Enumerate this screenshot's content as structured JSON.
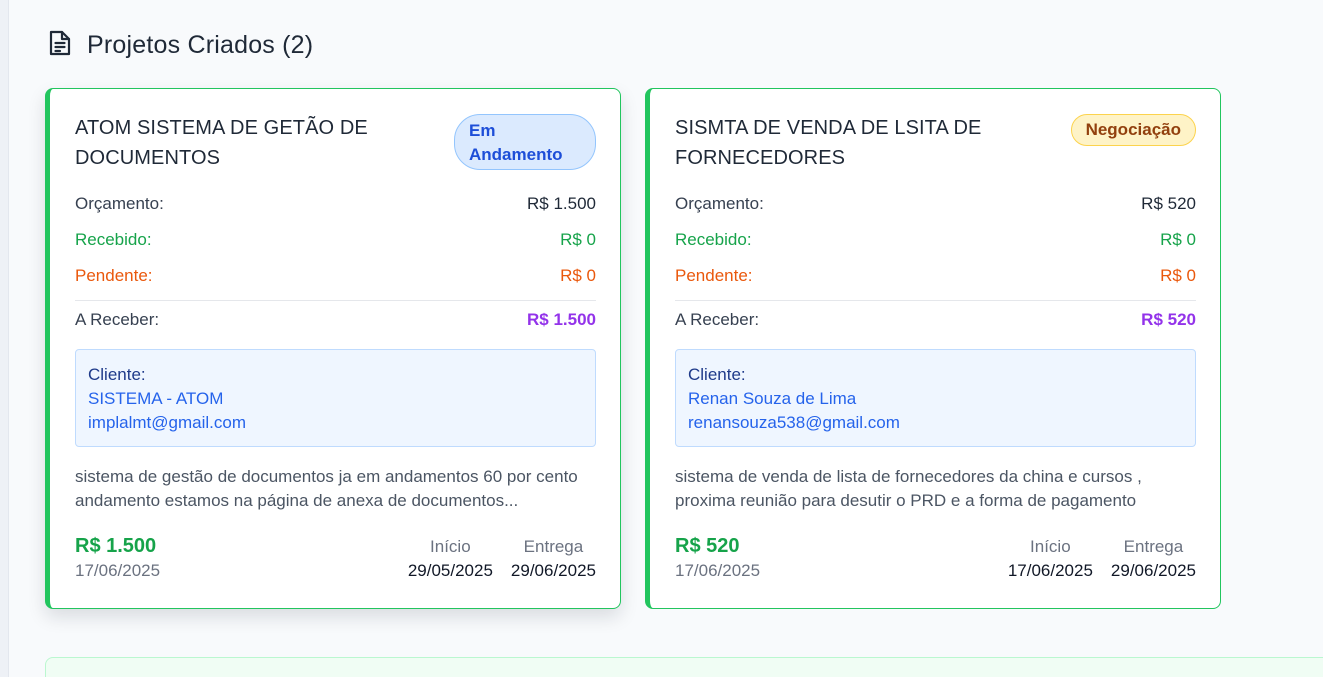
{
  "section": {
    "title": "Projetos Criados (2)",
    "icon": "document-icon"
  },
  "colors": {
    "accent_green": "#22c55e",
    "received_green": "#16a34a",
    "pending_orange": "#ea580c",
    "to_receive_purple": "#9333ea",
    "badge_blue": "#dbeafe",
    "badge_yellow": "#fef3c7"
  },
  "projects": [
    {
      "title": "ATOM SISTEMA DE GETÃO DE DOCUMENTOS",
      "status": "Em Andamento",
      "status_color": "blue",
      "budget_label": "Orçamento:",
      "budget": "R$ 1.500",
      "received_label": "Recebido:",
      "received": "R$ 0",
      "pending_label": "Pendente:",
      "pending": "R$ 0",
      "to_receive_label": "A Receber:",
      "to_receive": "R$ 1.500",
      "client_label": "Cliente:",
      "client_name": "SISTEMA - ATOM",
      "client_email": "implalmt@gmail.com",
      "description": "sistema de gestão de documentos ja em andamentos 60 por cento andamento estamos na página de anexa de documentos...",
      "total": "R$ 1.500",
      "created": "17/06/2025",
      "start_label": "Início",
      "start": "29/05/2025",
      "delivery_label": "Entrega",
      "delivery": "29/06/2025"
    },
    {
      "title": "SISMTA DE VENDA DE LSITA DE FORNECEDORES",
      "status": "Negociação",
      "status_color": "yellow",
      "budget_label": "Orçamento:",
      "budget": "R$ 520",
      "received_label": "Recebido:",
      "received": "R$ 0",
      "pending_label": "Pendente:",
      "pending": "R$ 0",
      "to_receive_label": "A Receber:",
      "to_receive": "R$ 520",
      "client_label": "Cliente:",
      "client_name": "Renan Souza de Lima",
      "client_email": "renansouza538@gmail.com",
      "description": "sistema de venda de lista de fornecedores da china e cursos , proxima reunião para desutir o PRD e a forma de pagamento",
      "total": "R$ 520",
      "created": "17/06/2025",
      "start_label": "Início",
      "start": "17/06/2025",
      "delivery_label": "Entrega",
      "delivery": "29/06/2025"
    }
  ]
}
